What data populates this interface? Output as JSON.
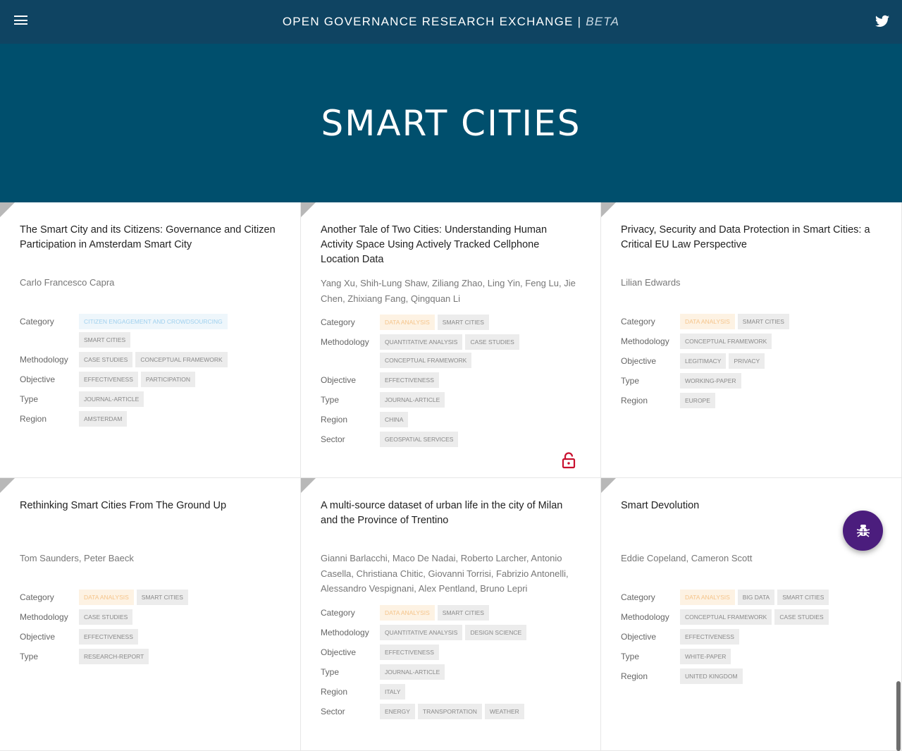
{
  "header": {
    "title": "OPEN GOVERNANCE RESEARCH EXCHANGE",
    "separator": "|",
    "beta": "BETA",
    "menu_icon": "hamburger-menu-icon",
    "social_icon": "twitter-icon"
  },
  "hero": {
    "title": "SMART CITIES"
  },
  "labels": {
    "category": "Category",
    "methodology": "Methodology",
    "objective": "Objective",
    "type": "Type",
    "region": "Region",
    "sector": "Sector"
  },
  "colors": {
    "topbar": "#0f4462",
    "hero": "#004f6d",
    "fab": "#4b1d7d",
    "lock": "#c8102e"
  },
  "cards": [
    {
      "title": "The Smart City and its Citizens: Governance and Citizen Participation in Amsterdam Smart City",
      "authors": "Carlo Francesco Capra",
      "category": [
        [
          "CITIZEN ENGAGEMENT AND CROWDSOURCING",
          "blue"
        ],
        [
          "SMART CITIES",
          ""
        ]
      ],
      "methodology": [
        "CASE STUDIES",
        "CONCEPTUAL FRAMEWORK"
      ],
      "objective": [
        "EFFECTIVENESS",
        "PARTICIPATION"
      ],
      "type": [
        "JOURNAL-ARTICLE"
      ],
      "region": [
        "AMSTERDAM"
      ]
    },
    {
      "title": "Another Tale of Two Cities: Understanding Human Activity Space Using Actively Tracked Cellphone Location Data",
      "authors": "Yang Xu, Shih-Lung Shaw, Ziliang Zhao, Ling Yin, Feng Lu, Jie Chen, Zhixiang Fang, Qingquan Li",
      "category": [
        [
          "DATA ANALYSIS",
          "orange"
        ],
        [
          "SMART CITIES",
          ""
        ]
      ],
      "methodology": [
        "QUANTITATIVE ANALYSIS",
        "CASE STUDIES",
        "CONCEPTUAL FRAMEWORK"
      ],
      "objective": [
        "EFFECTIVENESS"
      ],
      "type": [
        "JOURNAL-ARTICLE"
      ],
      "region": [
        "CHINA"
      ],
      "sector": [
        "GEOSPATIAL SERVICES"
      ],
      "locked": true
    },
    {
      "title": "Privacy, Security and Data Protection in Smart Cities: a Critical EU Law Perspective",
      "authors": "Lilian Edwards",
      "category": [
        [
          "DATA ANALYSIS",
          "orange"
        ],
        [
          "SMART CITIES",
          ""
        ]
      ],
      "methodology": [
        "CONCEPTUAL FRAMEWORK"
      ],
      "objective": [
        "LEGITIMACY",
        "PRIVACY"
      ],
      "type": [
        "WORKING-PAPER"
      ],
      "region": [
        "EUROPE"
      ]
    },
    {
      "title": "Rethinking Smart Cities From The Ground Up",
      "authors": "Tom Saunders, Peter Baeck",
      "category": [
        [
          "DATA ANALYSIS",
          "orange"
        ],
        [
          "SMART CITIES",
          ""
        ]
      ],
      "methodology": [
        "CASE STUDIES"
      ],
      "objective": [
        "EFFECTIVENESS"
      ],
      "type": [
        "RESEARCH-REPORT"
      ]
    },
    {
      "title": "A multi-source dataset of urban life in the city of Milan and the Province of Trentino",
      "authors": "Gianni Barlacchi, Maco De Nadai, Roberto Larcher, Antonio Casella, Christiana Chitic, Giovanni Torrisi, Fabrizio Antonelli, Alessandro Vespignani, Alex Pentland, Bruno Lepri",
      "category": [
        [
          "DATA ANALYSIS",
          "orange"
        ],
        [
          "SMART CITIES",
          ""
        ]
      ],
      "methodology": [
        "QUANTITATIVE ANALYSIS",
        "DESIGN SCIENCE"
      ],
      "objective": [
        "EFFECTIVENESS"
      ],
      "type": [
        "JOURNAL-ARTICLE"
      ],
      "region": [
        "ITALY"
      ],
      "sector": [
        "ENERGY",
        "TRANSPORTATION",
        "WEATHER"
      ]
    },
    {
      "title": "Smart Devolution",
      "authors": "Eddie Copeland, Cameron Scott",
      "category": [
        [
          "DATA ANALYSIS",
          "orange"
        ],
        [
          "BIG DATA",
          ""
        ],
        [
          "SMART CITIES",
          ""
        ]
      ],
      "methodology": [
        "CONCEPTUAL FRAMEWORK",
        "CASE STUDIES"
      ],
      "objective": [
        "EFFECTIVENESS"
      ],
      "type": [
        "WHITE-PAPER"
      ],
      "region": [
        "UNITED KINGDOM"
      ]
    }
  ],
  "fab": {
    "icon": "bug-icon"
  }
}
